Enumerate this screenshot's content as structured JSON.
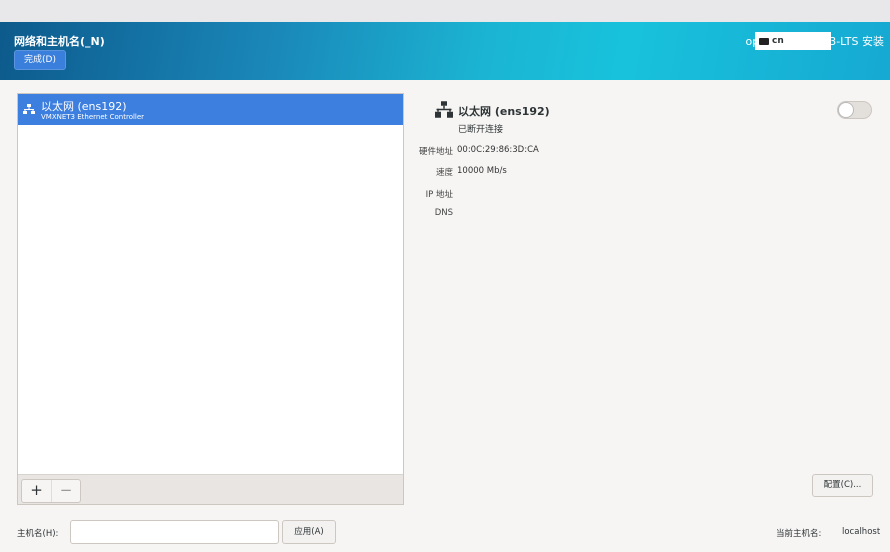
{
  "header": {
    "title": "网络和主机名(_N)",
    "done_label": "完成(D)",
    "product": "openEuler 24.03-LTS 安装",
    "keyboard_layout": "cn"
  },
  "list": {
    "items": [
      {
        "name": "以太网 (ens192)",
        "description": "VMXNET3 Ethernet Controller"
      }
    ],
    "add_label": "+",
    "remove_label": "−"
  },
  "device": {
    "name": "以太网 (ens192)",
    "status": "已断开连接",
    "enabled": false,
    "fields": [
      {
        "label": "硬件地址",
        "value": "00:0C:29:86:3D:CA"
      },
      {
        "label": "速度",
        "value": "10000 Mb/s"
      },
      {
        "label": "IP 地址",
        "value": ""
      },
      {
        "label": "DNS",
        "value": ""
      }
    ],
    "configure_label": "配置(C)..."
  },
  "hostname": {
    "label": "主机名(H):",
    "value": "",
    "placeholder": "",
    "apply_label": "应用(A)",
    "current_label": "当前主机名:",
    "current_value": "localhost"
  }
}
